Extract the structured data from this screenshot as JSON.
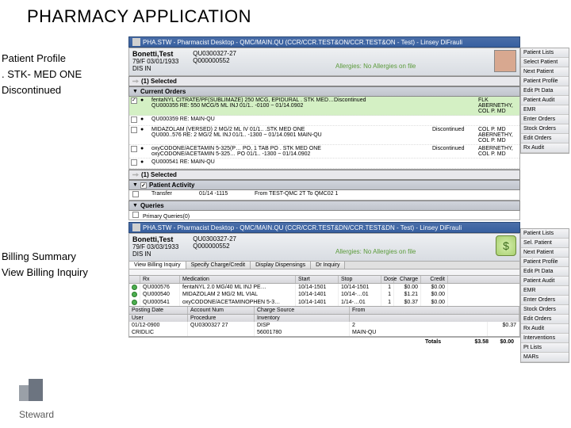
{
  "page_title": "PHARMACY APPLICATION",
  "left_notes": {
    "a1": "Patient Profile",
    "a2": ". STK- MED ONE",
    "a3": "Discontinued",
    "b1": "Billing Summary",
    "b2": "View Billing Inquiry"
  },
  "win1": {
    "titlebar": "PHA.STW - Pharmacist Desktop - QMC/MAIN.QU (CCR/CCR.TEST&ON/CCR.TEST&ON - Test) - Linsey DiFrauli",
    "patient": {
      "name": "Bonetti,Test",
      "line2": "79/F  03/01/1933",
      "line3": "DIS IN",
      "acct": "QU0300327-27",
      "mrn": "Q000000552",
      "allergies": "Allergies: No Allergies on file"
    },
    "sel_hdr": "(1) Selected",
    "orders_hdr": "Current Orders",
    "orders": [
      {
        "chk": true,
        "green": true,
        "med": "fentaNYL CITRATE/PF(SUBLIMAZE) 250 MCG, EPIDURAL . STK MED…Discontinued",
        "l2": "QU000355 RE: 550 MCG/5 ML INJ    01/1.. -0100 ~ 01/14.0902",
        "status": "",
        "init": "FLK\nABERNETHY,\nCOL P. MD"
      },
      {
        "chk": false,
        "green": false,
        "med": "QU000359 RE:                          MAIN-QU",
        "l2": "",
        "status": "",
        "init": ""
      },
      {
        "chk": false,
        "green": false,
        "med": "MIDAZOLAM (VERSED) 2 MG/2 ML IV                01/1.. .STK MED ONE",
        "l2": "QU000..576  RE: 2 MG/2 ML INJ     01/1.. -1300 ~ 01/14.0901   MAIN-QU",
        "status": "Discontinued",
        "init": "COL P. MD\nABERNETHY,\nCOL P. MD"
      },
      {
        "chk": false,
        "green": false,
        "med": "oxyCODONE/ACETAMIN 5-325(P…  PO, 1 TAB  PO . STK MED ONE",
        "l2": "oxyCODONE/ACETAMIN 5-325…  PO    01/1.. -1300 ~ 01/14.0902",
        "status": "Discontinued",
        "init": "ABERNETHY,\nCOL P. MD"
      },
      {
        "chk": false,
        "green": false,
        "med": "QU000541 RE:                          MAIN-QU",
        "l2": "",
        "status": "",
        "init": ""
      }
    ],
    "sel_ftr": "(1) Selected",
    "activity_hdr": "Patient Activity",
    "activity": {
      "c1": "",
      "c2": "Transfer",
      "c3": "01/14 -1115",
      "c4": "From TEST-QMC 2T  To QMC02 1"
    },
    "queries_hdr": "Queries",
    "queries_txt": "Primary Queries(0)",
    "right_panel": [
      "Patient Lists",
      "Select Patient",
      "Next Patient",
      "Patient Profile",
      "Edit Pt Data",
      "Patient Audit",
      "EMR",
      "Enter Orders",
      "Stock Orders",
      "Edit Orders",
      "Rx Audit"
    ]
  },
  "win2": {
    "titlebar": "PHA.STW - Pharmacist Desktop - QMC/MAIN.QU (CCR/CCR.TEST&DN/CCR.TEST&DN - Test) - Linsey DiFrauli",
    "patient": {
      "name": "Bonetti,Test",
      "line2": "79/F  03/03/1933",
      "line3": "DIS IN",
      "acct": "QU0300327-27",
      "mrn": "Q000000552",
      "allergies": "Allergies: No Allergies on file"
    },
    "tabs": [
      "View Billing Inquiry",
      "Specify Charge/Credit",
      "Display Dispensings",
      "Dr Inquiry"
    ],
    "bill_cols": {
      "c1": "",
      "c2": "Rx",
      "c3": "Medication",
      "c4": "Start",
      "c5": "Stop",
      "c6": "Dose",
      "c7": "Charge",
      "c8": "Credit"
    },
    "bill_rows": [
      {
        "id": "QU000576",
        "med": "fentaNYL 2.0 MG/40 ML INJ PE…",
        "d1": "10/14-1501",
        "d2": "10/14-1501",
        "n": "1",
        "p1": "$0.00",
        "p2": "$0.00"
      },
      {
        "id": "QU000540",
        "med": "MIDAZOLAM 2 MG/2 ML VIAL",
        "d1": "10/14-1401",
        "d2": "10/14-…01",
        "n": "1",
        "p1": "$1.21",
        "p2": "$0.00"
      },
      {
        "id": "QU000541",
        "med": "oxyCODONE/ACETAMINOPHEN 5-3…",
        "d1": "10/14-1401",
        "d2": "1/14-…01",
        "n": "1",
        "p1": "$0.37",
        "p2": "$0.00"
      }
    ],
    "sub_cols": {
      "c1": "Posting Date",
      "c2": "Account Num",
      "c3": "Charge Source",
      "c4": "From"
    },
    "sub_cols2": {
      "c1": "User",
      "c2": "Procedure",
      "c3": "Inventory"
    },
    "sub_rows": [
      {
        "d": "01/12-0900",
        "a": "QU0300327 27",
        "p": "DISP",
        "i": "2",
        "amt": "$0.37"
      },
      {
        "d": "CRIDLIC",
        "a": "",
        "p": "56001780",
        "i": "MAIN-QU",
        "amt": ""
      }
    ],
    "totals": {
      "label": "Totals",
      "v1": "$3.58",
      "v2": "$0.00"
    },
    "right_panel": [
      "Patient Lists",
      "Sel. Patient",
      "Next Patient",
      "Patient Profile",
      "Edit Pt Data",
      "Patient Audit",
      "EMR",
      "Enter Orders",
      "Stock Orders",
      "Edit Orders",
      "Rx Audit",
      "Interventions",
      "Pt Lists",
      "MARs"
    ]
  },
  "logo_text": "Steward"
}
